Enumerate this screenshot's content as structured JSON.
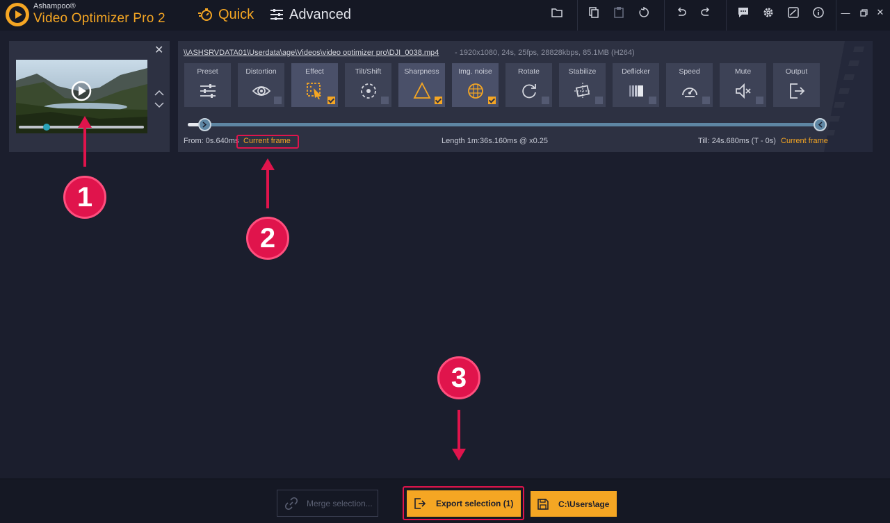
{
  "app": {
    "brand": "Ashampoo®",
    "name": "Video Optimizer Pro 2"
  },
  "modes": {
    "quick": "Quick",
    "advanced": "Advanced"
  },
  "file": {
    "path": "\\\\ASHSRVDATA01\\Userdata\\age\\Videos\\video optimizer pro\\DJI_0038.mp4",
    "info": "-   1920x1080, 24s, 25fps, 28828kbps, 85.1MB (H264)"
  },
  "tools": [
    {
      "label": "Preset",
      "icon": "sliders-icon",
      "checked": false,
      "active": false
    },
    {
      "label": "Distortion",
      "icon": "eye-icon",
      "checked": false,
      "active": false
    },
    {
      "label": "Effect",
      "icon": "effect-icon",
      "checked": true,
      "active": true
    },
    {
      "label": "Tilt/Shift",
      "icon": "focus-icon",
      "checked": false,
      "active": false
    },
    {
      "label": "Sharpness",
      "icon": "triangle-icon",
      "checked": true,
      "active": true
    },
    {
      "label": "Img. noise",
      "icon": "noise-icon",
      "checked": true,
      "active": true
    },
    {
      "label": "Rotate",
      "icon": "rotate-icon",
      "checked": false,
      "active": false
    },
    {
      "label": "Stabilize",
      "icon": "stabilize-icon",
      "checked": false,
      "active": false
    },
    {
      "label": "Deflicker",
      "icon": "deflicker-icon",
      "checked": false,
      "active": false
    },
    {
      "label": "Speed",
      "icon": "speedometer-icon",
      "checked": false,
      "active": false
    },
    {
      "label": "Mute",
      "icon": "mute-icon",
      "checked": false,
      "active": false
    },
    {
      "label": "Output",
      "icon": "output-icon",
      "checked": false,
      "active": false
    }
  ],
  "timeline": {
    "from": "From:  0s.640ms",
    "current_frame_left": "Current frame",
    "length": "Length  1m:36s.160ms @ x0.25",
    "till": "Till:  24s.680ms (T - 0s)",
    "current_frame_right": "Current frame"
  },
  "annotations": [
    "1",
    "2",
    "3"
  ],
  "bottom": {
    "merge": "Merge selection...",
    "export": "Export selection (1)",
    "path": "C:\\Users\\age"
  },
  "colors": {
    "accent": "#f5a623",
    "annotation": "#e0144c",
    "background": "#1b1e2d",
    "panel": "#2d3142"
  }
}
